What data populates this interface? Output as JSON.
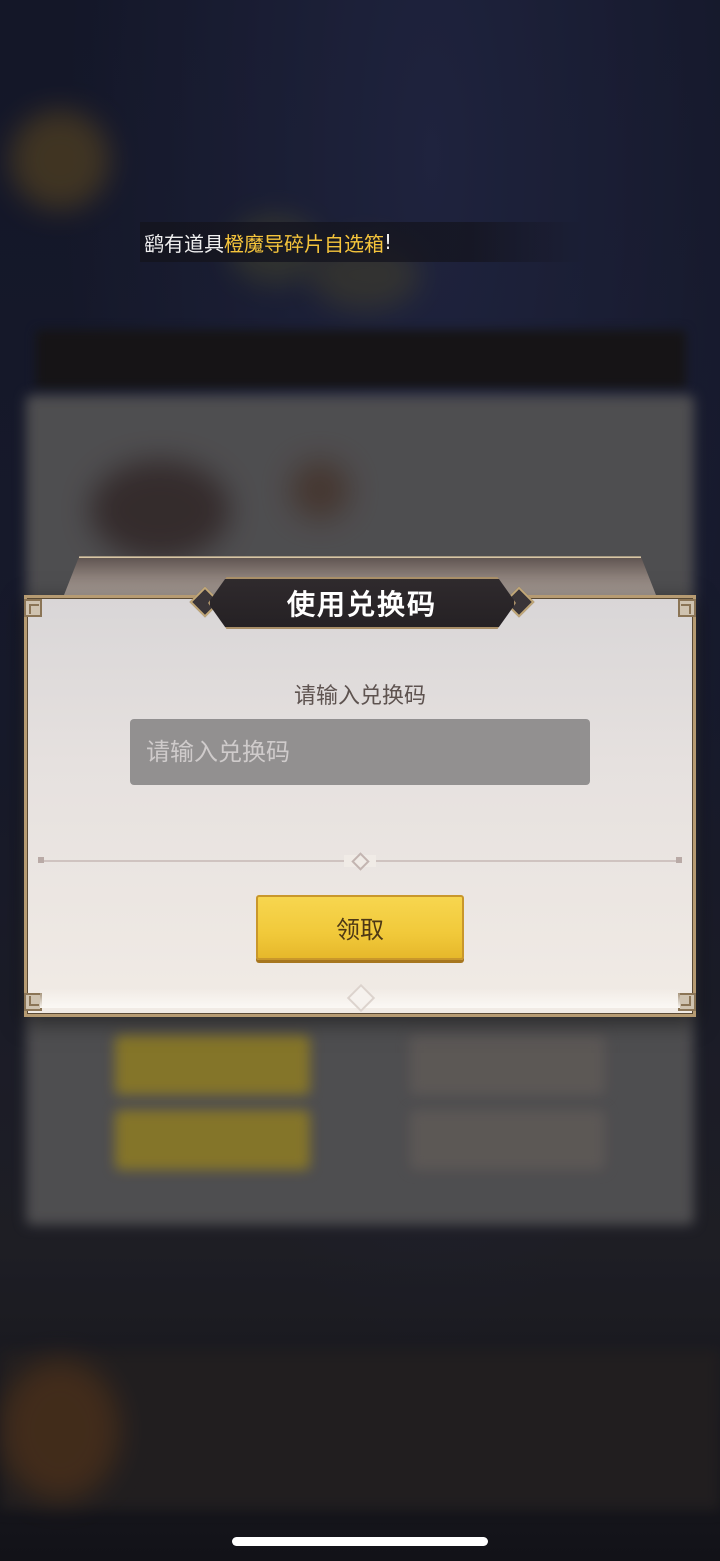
{
  "marquee": {
    "prefix": "获得稀有道具",
    "visible_prefix": "鹞有道具",
    "item": "橙魔导碎片自选箱",
    "suffix": "!"
  },
  "dialog": {
    "title": "使用兑换码",
    "prompt": "请输入兑换码",
    "input": {
      "value": "",
      "placeholder": "请输入兑换码"
    },
    "claim_button": "领取"
  },
  "colors": {
    "highlight": "#f5c43b",
    "button": "#f1c93a",
    "title_plate": "#2a2528",
    "frame_gold": "#b69b72"
  },
  "icons": {
    "frame_corners": "corner-ornament-icon",
    "title_gems": "diamond-ornament-icon",
    "divider": "diamond-divider-icon"
  }
}
